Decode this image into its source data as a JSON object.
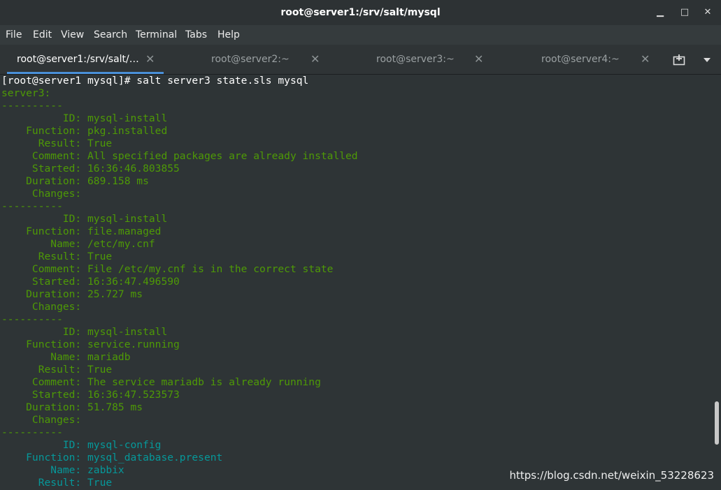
{
  "window": {
    "title": "root@server1:/srv/salt/mysql",
    "minimize": "▁",
    "maximize": "□",
    "close": "✕"
  },
  "menu": [
    "File",
    "Edit",
    "View",
    "Search",
    "Terminal",
    "Tabs",
    "Help"
  ],
  "tabs": [
    {
      "label": "root@server1:/srv/salt/…",
      "active": true
    },
    {
      "label": "root@server2:~",
      "active": false
    },
    {
      "label": "root@server3:~",
      "active": false
    },
    {
      "label": "root@server4:~",
      "active": false
    }
  ],
  "tab_close_glyph": "✕",
  "terminal": {
    "lines": [
      {
        "text": "[root@server1 mysql]# salt server3 state.sls mysql",
        "color": "white"
      },
      {
        "text": "server3:",
        "color": "green"
      },
      {
        "text": "----------",
        "color": "green"
      },
      {
        "text": "          ID: mysql-install",
        "color": "green"
      },
      {
        "text": "    Function: pkg.installed",
        "color": "green"
      },
      {
        "text": "      Result: True",
        "color": "green"
      },
      {
        "text": "     Comment: All specified packages are already installed",
        "color": "green"
      },
      {
        "text": "     Started: 16:36:46.803855",
        "color": "green"
      },
      {
        "text": "    Duration: 689.158 ms",
        "color": "green"
      },
      {
        "text": "     Changes:",
        "color": "green"
      },
      {
        "text": "----------",
        "color": "green"
      },
      {
        "text": "          ID: mysql-install",
        "color": "green"
      },
      {
        "text": "    Function: file.managed",
        "color": "green"
      },
      {
        "text": "        Name: /etc/my.cnf",
        "color": "green"
      },
      {
        "text": "      Result: True",
        "color": "green"
      },
      {
        "text": "     Comment: File /etc/my.cnf is in the correct state",
        "color": "green"
      },
      {
        "text": "     Started: 16:36:47.496590",
        "color": "green"
      },
      {
        "text": "    Duration: 25.727 ms",
        "color": "green"
      },
      {
        "text": "     Changes:",
        "color": "green"
      },
      {
        "text": "----------",
        "color": "green"
      },
      {
        "text": "          ID: mysql-install",
        "color": "green"
      },
      {
        "text": "    Function: service.running",
        "color": "green"
      },
      {
        "text": "        Name: mariadb",
        "color": "green"
      },
      {
        "text": "      Result: True",
        "color": "green"
      },
      {
        "text": "     Comment: The service mariadb is already running",
        "color": "green"
      },
      {
        "text": "     Started: 16:36:47.523573",
        "color": "green"
      },
      {
        "text": "    Duration: 51.785 ms",
        "color": "green"
      },
      {
        "text": "     Changes:",
        "color": "green"
      },
      {
        "text": "----------",
        "color": "green"
      },
      {
        "text": "          ID: mysql-config",
        "color": "cyan"
      },
      {
        "text": "    Function: mysql_database.present",
        "color": "cyan"
      },
      {
        "text": "        Name: zabbix",
        "color": "cyan"
      },
      {
        "text": "      Result: True",
        "color": "cyan"
      }
    ]
  },
  "watermark": "https://blog.csdn.net/weixin_53228623",
  "colors": {
    "green": "#4e9a06",
    "cyan": "#06989a",
    "accent": "#4a90d9"
  }
}
